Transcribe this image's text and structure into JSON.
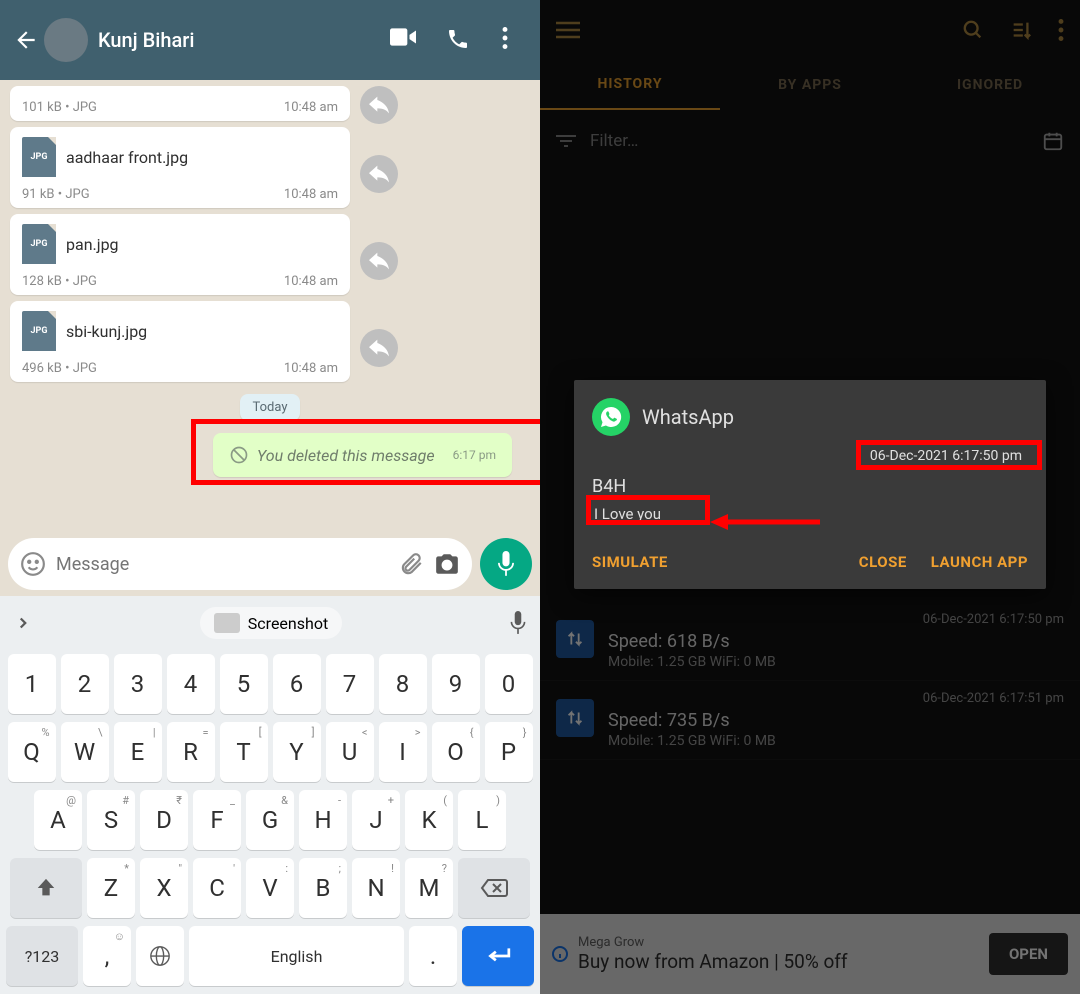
{
  "left": {
    "contact_name": "Kunj Bihari",
    "attachments": [
      {
        "name": "",
        "size": "101 kB",
        "type": "JPG",
        "time": "10:48 am"
      },
      {
        "name": "aadhaar front.jpg",
        "size": "91 kB",
        "type": "JPG",
        "time": "10:48 am"
      },
      {
        "name": "pan.jpg",
        "size": "128 kB",
        "type": "JPG",
        "time": "10:48 am"
      },
      {
        "name": "sbi-kunj.jpg",
        "size": "496 kB",
        "type": "JPG",
        "time": "10:48 am"
      }
    ],
    "date_pill": "Today",
    "deleted_text": "You deleted this message",
    "deleted_time": "6:17 pm",
    "input_placeholder": "Message",
    "keyboard": {
      "suggest": "Screenshot",
      "row1": [
        {
          "k": "1",
          "s": ""
        },
        {
          "k": "2",
          "s": ""
        },
        {
          "k": "3",
          "s": ""
        },
        {
          "k": "4",
          "s": ""
        },
        {
          "k": "5",
          "s": ""
        },
        {
          "k": "6",
          "s": ""
        },
        {
          "k": "7",
          "s": ""
        },
        {
          "k": "8",
          "s": ""
        },
        {
          "k": "9",
          "s": ""
        },
        {
          "k": "0",
          "s": ""
        }
      ],
      "row2": [
        {
          "k": "Q",
          "s": "%"
        },
        {
          "k": "W",
          "s": "\\"
        },
        {
          "k": "E",
          "s": "|"
        },
        {
          "k": "R",
          "s": "="
        },
        {
          "k": "T",
          "s": "["
        },
        {
          "k": "Y",
          "s": "]"
        },
        {
          "k": "U",
          "s": "<"
        },
        {
          "k": "I",
          "s": ">"
        },
        {
          "k": "O",
          "s": "{"
        },
        {
          "k": "P",
          "s": "}"
        }
      ],
      "row3": [
        {
          "k": "A",
          "s": "@"
        },
        {
          "k": "S",
          "s": "#"
        },
        {
          "k": "D",
          "s": "₹"
        },
        {
          "k": "F",
          "s": "_"
        },
        {
          "k": "G",
          "s": "&"
        },
        {
          "k": "H",
          "s": "-"
        },
        {
          "k": "J",
          "s": "+"
        },
        {
          "k": "K",
          "s": "("
        },
        {
          "k": "L",
          "s": ")"
        }
      ],
      "row4": [
        {
          "k": "Z",
          "s": "*"
        },
        {
          "k": "X",
          "s": "\""
        },
        {
          "k": "C",
          "s": "'"
        },
        {
          "k": "V",
          "s": ":"
        },
        {
          "k": "B",
          "s": ";"
        },
        {
          "k": "N",
          "s": "!"
        },
        {
          "k": "M",
          "s": "?"
        }
      ],
      "sym_key": "?123",
      "space_label": "English"
    }
  },
  "right": {
    "tabs": {
      "history": "HISTORY",
      "by_apps": "BY APPS",
      "ignored": "IGNORED"
    },
    "filter_placeholder": "Filter…",
    "popup": {
      "app_name": "WhatsApp",
      "timestamp": "06-Dec-2021 6:17:50 pm",
      "sender": "B4H",
      "message": "I Love you",
      "simulate": "SIMULATE",
      "close": "CLOSE",
      "launch": "LAUNCH APP"
    },
    "list": [
      {
        "time": "06-Dec-2021 6:17:50 pm",
        "title": "Speed: 618 B/s",
        "sub": "Mobile: 1.25 GB   WiFi: 0 MB"
      },
      {
        "time": "06-Dec-2021 6:17:51 pm",
        "title": "Speed: 735 B/s",
        "sub": "Mobile: 1.25 GB   WiFi: 0 MB"
      }
    ],
    "ad": {
      "line1": "Mega Grow",
      "line2": "Buy now from Amazon | 50% off",
      "cta": "OPEN"
    }
  }
}
